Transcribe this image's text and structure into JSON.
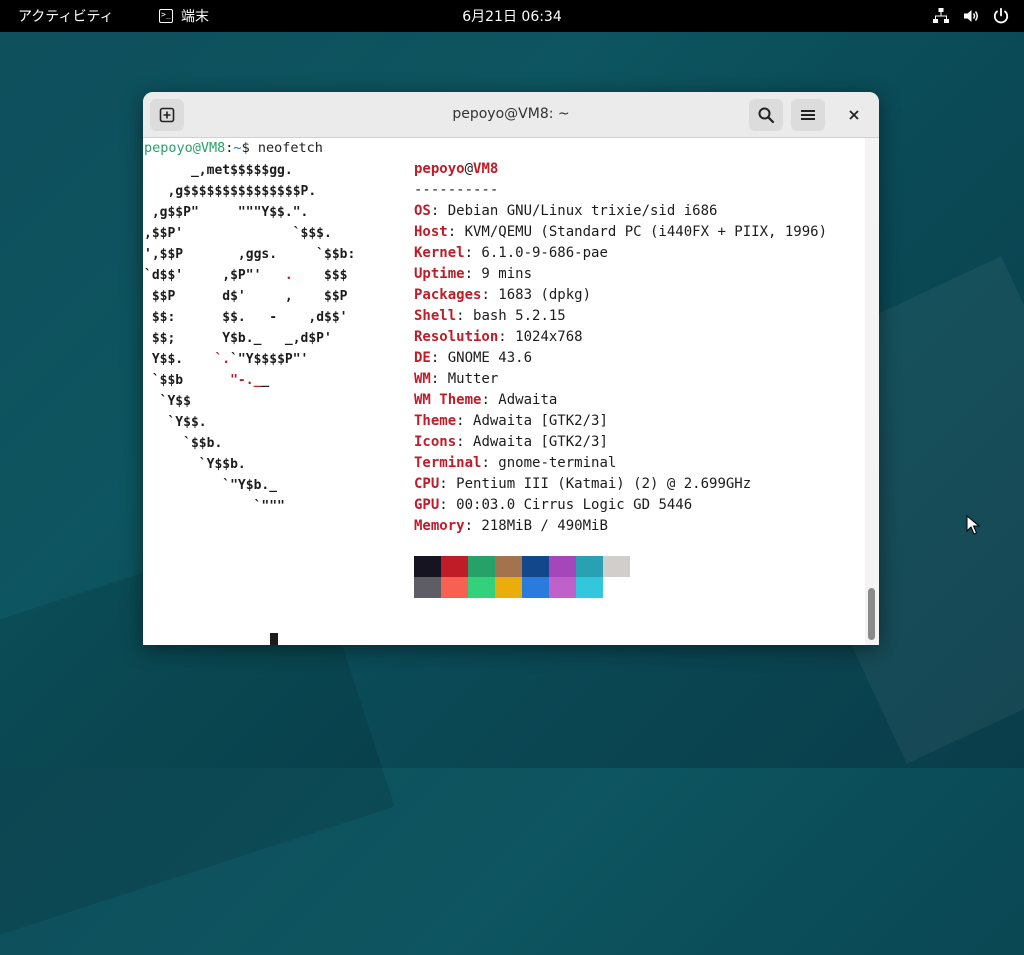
{
  "topbar": {
    "activities": "アクティビティ",
    "app_name": "端末",
    "clock": "6月21日 06:34"
  },
  "window": {
    "title": "pepoyo@VM8: ~"
  },
  "terminal": {
    "prompt_user": "pepoyo@VM8",
    "prompt_sep": ":",
    "prompt_path": "~",
    "prompt_symbol": "$ ",
    "command": "neofetch",
    "ascii_art": "      _,met$$$$$gg.\n   ,g$$$$$$$$$$$$$$$P.\n ,g$$P\"     \"\"\"Y$$.\".\n,$$P'              `$$$.\n',$$P       ,ggs.     `$$b:\n`d$$'     ,$P\"'   .    $$$\n $$P      d$'     ,    $$P\n $$:      $$.   -    ,d$$'\n $$;      Y$b._   _,d$P'\n Y$$.    `.`\"Y$$$$P\"'\n `$$b      \"-.__\n  `Y$$\n   `Y$$.\n     `$$b.\n       `Y$$b.\n          `\"Y$b._\n              `\"\"\"",
    "info_user": "pepoyo",
    "info_at": "@",
    "info_host": "VM8",
    "separator": "----------",
    "info": [
      {
        "label": "OS",
        "value": ": Debian GNU/Linux trixie/sid i686"
      },
      {
        "label": "Host",
        "value": ": KVM/QEMU (Standard PC (i440FX + PIIX, 1996)"
      },
      {
        "label": "Kernel",
        "value": ": 6.1.0-9-686-pae"
      },
      {
        "label": "Uptime",
        "value": ": 9 mins"
      },
      {
        "label": "Packages",
        "value": ": 1683 (dpkg)"
      },
      {
        "label": "Shell",
        "value": ": bash 5.2.15"
      },
      {
        "label": "Resolution",
        "value": ": 1024x768"
      },
      {
        "label": "DE",
        "value": ": GNOME 43.6"
      },
      {
        "label": "WM",
        "value": ": Mutter"
      },
      {
        "label": "WM Theme",
        "value": ": Adwaita"
      },
      {
        "label": "Theme",
        "value": ": Adwaita [GTK2/3]"
      },
      {
        "label": "Icons",
        "value": ": Adwaita [GTK2/3]"
      },
      {
        "label": "Terminal",
        "value": ": gnome-terminal"
      },
      {
        "label": "CPU",
        "value": ": Pentium III (Katmai) (2) @ 2.699GHz"
      },
      {
        "label": "GPU",
        "value": ": 00:03.0 Cirrus Logic GD 5446"
      },
      {
        "label": "Memory",
        "value": ": 218MiB / 490MiB"
      }
    ],
    "palette_top": [
      "#171421",
      "#c01c28",
      "#26a269",
      "#a2734c",
      "#12488b",
      "#a347ba",
      "#2aa1b3",
      "#d0cfcc"
    ],
    "palette_bottom": [
      "#5e5c64",
      "#f66151",
      "#33d17a",
      "#e9ad0c",
      "#2a7bde",
      "#c061cb",
      "#33c7de",
      "#ffffff"
    ]
  }
}
